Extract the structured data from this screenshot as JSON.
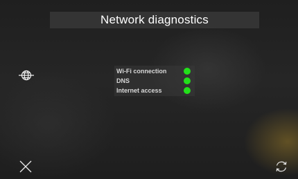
{
  "header": {
    "title": "Network diagnostics"
  },
  "checks": [
    {
      "label": "Wi-Fi connection",
      "status": "ok",
      "status_color": "#22e01a"
    },
    {
      "label": "DNS",
      "status": "ok",
      "status_color": "#22e01a"
    },
    {
      "label": "Internet access",
      "status": "ok",
      "status_color": "#22e01a"
    }
  ],
  "icons": {
    "left": "globe-icon",
    "bottom_left": "close-icon",
    "bottom_right": "refresh-icon"
  },
  "colors": {
    "status_ok": "#22e01a",
    "text": "#ffffff"
  }
}
